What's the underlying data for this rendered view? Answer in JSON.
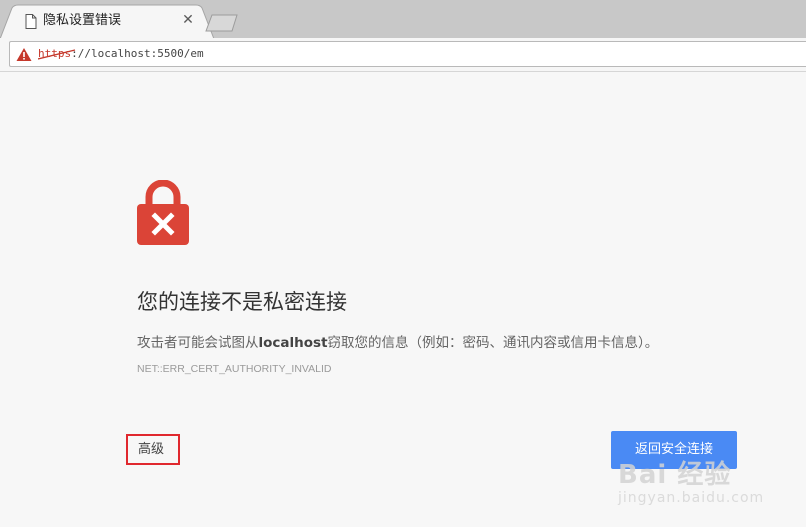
{
  "tab": {
    "title": "隐私设置错误",
    "close_glyph": "✕",
    "page_icon": "document-icon"
  },
  "omnibox": {
    "scheme": "https",
    "rest": "://localhost:5500/em",
    "security_icon": "warning-triangle-icon"
  },
  "page": {
    "heading": "您的连接不是私密连接",
    "explanation_prefix": "攻击者可能会试图从",
    "explanation_host": "localhost",
    "explanation_suffix": "窃取您的信息（例如：密码、通讯内容或信用卡信息）。",
    "error_code": "NET::ERR_CERT_AUTHORITY_INVALID",
    "lock_icon": "broken-lock-icon"
  },
  "buttons": {
    "advanced_label": "高级",
    "back_label": "返回安全连接"
  },
  "watermark": {
    "brand": "Bai 经验",
    "url": "jingyan.baidu.com"
  },
  "colors": {
    "accent_blue": "#4a8af4",
    "lock_red": "#db4437",
    "highlight_red": "#e0282e"
  }
}
